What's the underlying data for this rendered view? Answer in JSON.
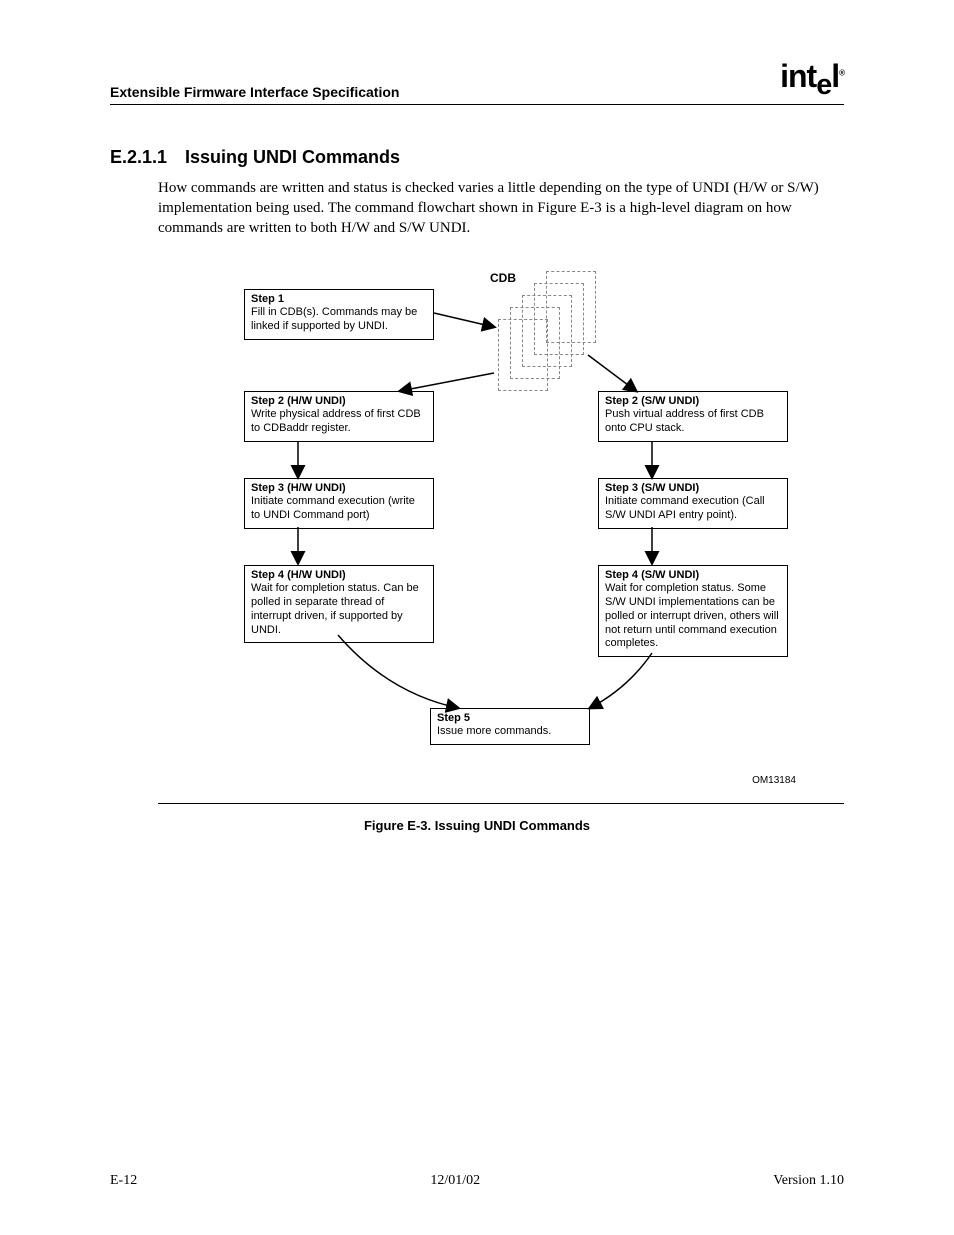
{
  "header": {
    "doc_title": "Extensible Firmware Interface Specification",
    "logo": "intel"
  },
  "section": {
    "number": "E.2.1.1",
    "title": "Issuing UNDI Commands"
  },
  "paragraph": "How commands are written and status is checked varies a little depending on the type of UNDI (H/W or S/W) implementation being used.  The command flowchart shown in Figure E-3 is a high-level diagram on how commands are written to both H/W and S/W UNDI.",
  "diagram": {
    "cdb_label": "CDB",
    "step1": {
      "title": "Step 1",
      "text": "Fill in CDB(s).  Commands may be linked if supported by UNDI."
    },
    "step2hw": {
      "title": "Step 2 (H/W UNDI)",
      "text": "Write physical address of first CDB to CDBaddr register."
    },
    "step2sw": {
      "title": "Step 2 (S/W UNDI)",
      "text": "Push virtual address of first CDB onto CPU stack."
    },
    "step3hw": {
      "title": "Step 3 (H/W UNDI)",
      "text": "Initiate command execution (write to UNDI Command port)"
    },
    "step3sw": {
      "title": "Step 3 (S/W UNDI)",
      "text": "Initiate command execution (Call S/W UNDI API entry point)."
    },
    "step4hw": {
      "title": "Step 4 (H/W UNDI)",
      "text": "Wait for completion status. Can be polled in separate thread of interrupt driven, if supported by UNDI."
    },
    "step4sw": {
      "title": "Step 4 (S/W UNDI)",
      "text": "Wait for completion status.  Some S/W UNDI implementations can be polled or interrupt driven, others will not return until command execution completes."
    },
    "step5": {
      "title": "Step 5",
      "text": "Issue more commands."
    },
    "code": "OM13184"
  },
  "figure_caption": "Figure E-3.  Issuing UNDI Commands",
  "footer": {
    "left": "E-12",
    "center": "12/01/02",
    "right": "Version 1.10"
  }
}
